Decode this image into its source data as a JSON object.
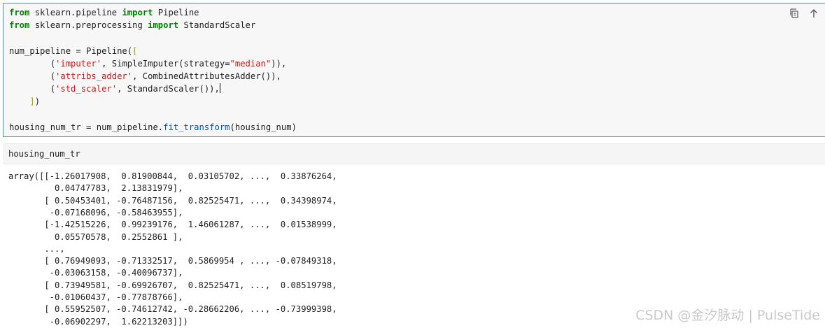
{
  "code_cell": {
    "lines": [
      [
        {
          "t": "kw",
          "v": "from"
        },
        {
          "t": "pl",
          "v": " sklearn.pipeline "
        },
        {
          "t": "kw",
          "v": "import"
        },
        {
          "t": "pl",
          "v": " Pipeline"
        }
      ],
      [
        {
          "t": "kw",
          "v": "from"
        },
        {
          "t": "pl",
          "v": " sklearn.preprocessing "
        },
        {
          "t": "kw",
          "v": "import"
        },
        {
          "t": "pl",
          "v": " StandardScaler"
        }
      ],
      [],
      [
        {
          "t": "pl",
          "v": "num_pipeline = Pipeline("
        },
        {
          "t": "br",
          "v": "["
        }
      ],
      [
        {
          "t": "pl",
          "v": "        ("
        },
        {
          "t": "str",
          "v": "'imputer'"
        },
        {
          "t": "pl",
          "v": ", SimpleImputer(strategy="
        },
        {
          "t": "str",
          "v": "\"median\""
        },
        {
          "t": "pl",
          "v": ")),"
        }
      ],
      [
        {
          "t": "pl",
          "v": "        ("
        },
        {
          "t": "str",
          "v": "'attribs_adder'"
        },
        {
          "t": "pl",
          "v": ", CombinedAttributesAdder()),"
        }
      ],
      [
        {
          "t": "pl",
          "v": "        ("
        },
        {
          "t": "str",
          "v": "'std_scaler'"
        },
        {
          "t": "pl",
          "v": ", StandardScaler()),"
        },
        {
          "t": "cursor",
          "v": ""
        }
      ],
      [
        {
          "t": "pl",
          "v": "    "
        },
        {
          "t": "br",
          "v": "]"
        },
        {
          "t": "pl",
          "v": ")"
        }
      ],
      [],
      [
        {
          "t": "pl",
          "v": "housing_num_tr = num_pipeline."
        },
        {
          "t": "fn",
          "v": "fit_transform"
        },
        {
          "t": "pl",
          "v": "(housing_num)"
        }
      ]
    ]
  },
  "toolbar": {
    "copy_icon": "copy-icon",
    "move_up_icon": "arrow-up-icon"
  },
  "input_cell": {
    "text": "housing_num_tr"
  },
  "output": {
    "lines": [
      "array([[-1.26017908,  0.81900844,  0.03105702, ...,  0.33876264,",
      "         0.04747783,  2.13831979],",
      "       [ 0.50453401, -0.76487156,  0.82525471, ...,  0.34398974,",
      "        -0.07168096, -0.58463955],",
      "       [-1.42515226,  0.99239176,  1.46061287, ...,  0.01538999,",
      "         0.05570578,  0.2552861 ],",
      "       ...,",
      "       [ 0.76949093, -0.71332517,  0.5869954 , ..., -0.07849318,",
      "        -0.03063158, -0.40096737],",
      "       [ 0.73949581, -0.69926707,  0.82525471, ...,  0.08519798,",
      "        -0.01060437, -0.77878766],",
      "       [ 0.55952507, -0.74612742, -0.28662206, ..., -0.73999398,",
      "        -0.06902297,  1.62213203]])"
    ]
  },
  "watermark": "CSDN @金汐脉动 | PulseTide",
  "colors": {
    "keyword": "#008000",
    "string": "#ba2121",
    "function": "#0055aa",
    "bracket": "#a0a030",
    "cell_border": "#4e8fd6"
  }
}
